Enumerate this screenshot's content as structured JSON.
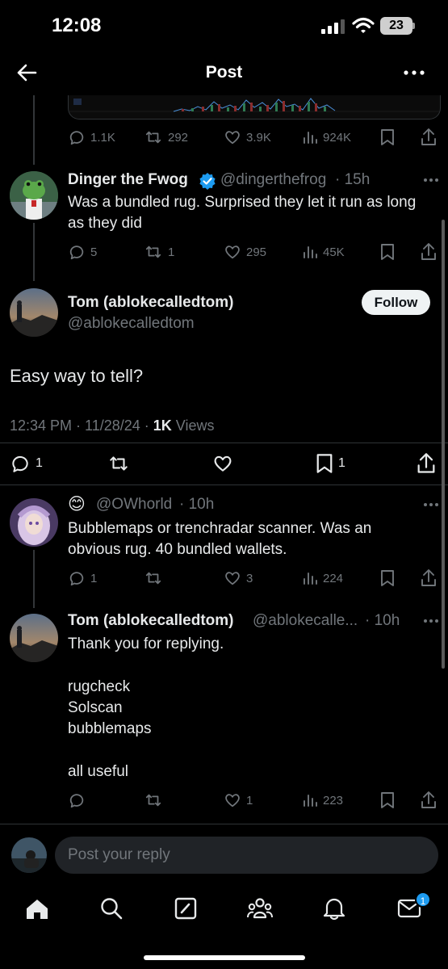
{
  "status_bar": {
    "time": "12:08",
    "battery": "23"
  },
  "header": {
    "title": "Post"
  },
  "top_tweet_actions": {
    "replies": "1.1K",
    "reposts": "292",
    "likes": "3.9K",
    "views": "924K"
  },
  "dinger": {
    "name": "Dinger the Fwog",
    "handle": "@dingerthefrog",
    "time": "· 15h",
    "text": "Was a bundled rug. Surprised they let it run as long as they did",
    "replies": "5",
    "reposts": "1",
    "likes": "295",
    "views": "45K"
  },
  "main_post": {
    "name": "Tom (ablokecalledtom)",
    "handle": "@ablokecalledtom",
    "follow_label": "Follow",
    "text": "Easy way to tell?",
    "meta_time": "12:34 PM · 11/28/24 · ",
    "views_count": "1K",
    "views_label": " Views",
    "replies": "1",
    "bookmarks": "1"
  },
  "owhorld": {
    "emoji": "😊",
    "handle": "@OWhorld",
    "time": "· 10h",
    "text": "Bubblemaps or trenchradar scanner. Was an obvious rug. 40 bundled wallets.",
    "replies": "1",
    "likes": "3",
    "views": "224"
  },
  "tom_reply": {
    "name": "Tom (ablokecalledtom)",
    "handle": "@ablokecalle...",
    "time": "· 10h",
    "lines": [
      "Thank you for replying.",
      "",
      "rugcheck",
      "Solscan",
      "bubblemaps",
      "",
      "all useful"
    ],
    "likes": "1",
    "views": "223"
  },
  "composer": {
    "placeholder": "Post your reply"
  },
  "tabbar": {
    "messages_badge": "1"
  },
  "colors": {
    "accent": "#1d9bf0",
    "muted": "#71767b",
    "text": "#e7e9ea"
  }
}
